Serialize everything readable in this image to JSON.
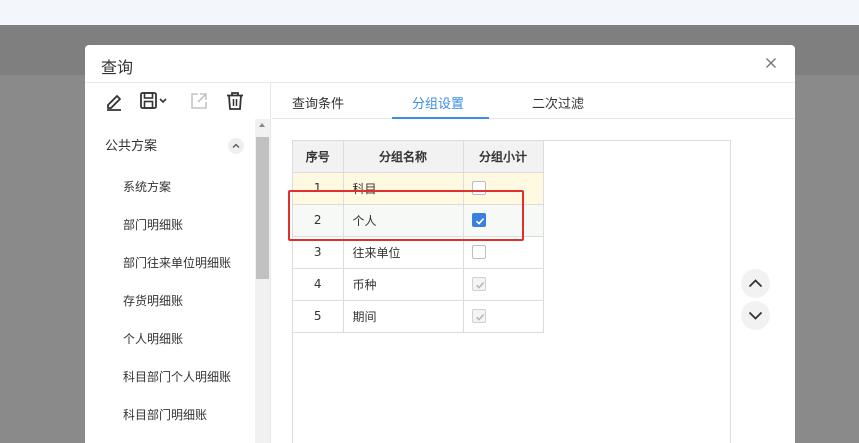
{
  "dialog": {
    "title": "查询",
    "close_icon": "close-icon"
  },
  "toolbar": {
    "edit_icon": "edit-icon",
    "save_icon": "save-dropdown-icon",
    "export_icon": "export-icon",
    "delete_icon": "delete-icon"
  },
  "schemes": {
    "group_title": "公共方案",
    "items": [
      "系统方案",
      "部门明细账",
      "部门往来单位明细账",
      "存货明细账",
      "个人明细账",
      "科目部门个人明细账",
      "科目部门明细账"
    ]
  },
  "tabs": [
    {
      "label": "查询条件",
      "active": false
    },
    {
      "label": "分组设置",
      "active": true
    },
    {
      "label": "二次过滤",
      "active": false
    }
  ],
  "grid": {
    "columns": [
      "序号",
      "分组名称",
      "分组小计"
    ],
    "rows": [
      {
        "no": "1",
        "name": "科目",
        "checked": false,
        "disabled": false
      },
      {
        "no": "2",
        "name": "个人",
        "checked": true,
        "disabled": false
      },
      {
        "no": "3",
        "name": "往来单位",
        "checked": false,
        "disabled": false
      },
      {
        "no": "4",
        "name": "币种",
        "checked": true,
        "disabled": true
      },
      {
        "no": "5",
        "name": "期间",
        "checked": true,
        "disabled": true
      }
    ]
  },
  "colors": {
    "accent": "#3b8ee8",
    "highlight_box": "#e0302c",
    "checkbox_checked": "#3b7fe0"
  }
}
